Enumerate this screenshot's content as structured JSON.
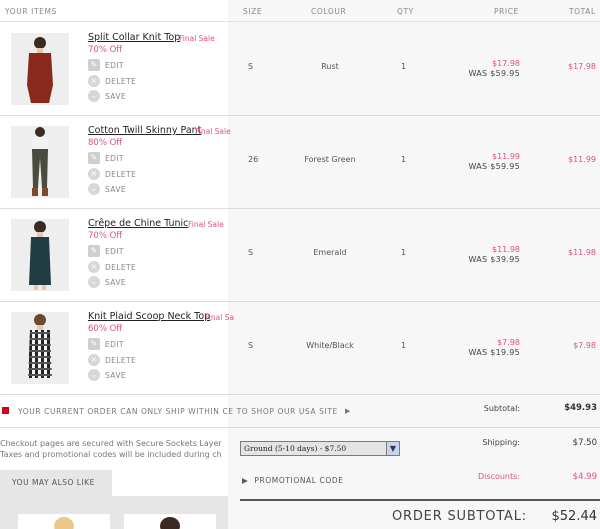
{
  "header": {
    "items": "YOUR ITEMS",
    "size": "SIZE",
    "colour": "COLOUR",
    "qty": "QTY",
    "price": "PRICE",
    "total": "TOTAL"
  },
  "actions": {
    "edit": "EDIT",
    "delete": "DELETE",
    "save": "SAVE"
  },
  "items": [
    {
      "name": "Split Collar Knit Top",
      "final": "Final Sale",
      "off": "70% Off",
      "size": "S",
      "colour": "Rust",
      "qty": "1",
      "price": "$17.98",
      "was": "WAS $59.95",
      "total": "$17.98",
      "image_color": "#8a2a1e"
    },
    {
      "name": "Cotton Twill Skinny Pant",
      "final": "Final Sale",
      "off": "80% Off",
      "size": "26",
      "colour": "Forest Green",
      "qty": "1",
      "price": "$11.99",
      "was": "WAS $59.95",
      "total": "$11.99",
      "image_color": "#4a4d3e"
    },
    {
      "name": "Crêpe de Chine Tunic",
      "final": "Final Sale",
      "off": "70% Off",
      "size": "S",
      "colour": "Emerald",
      "qty": "1",
      "price": "$11.98",
      "was": "WAS $39.95",
      "total": "$11.98",
      "image_color": "#1f3d42"
    },
    {
      "name": "Knit Plaid Scoop Neck Top",
      "final": "Final Sa",
      "off": "60% Off",
      "size": "S",
      "colour": "White/Black",
      "qty": "1",
      "price": "$7.98",
      "was": "WAS $19.95",
      "total": "$7.98",
      "image_color": "#2a2a2a"
    }
  ],
  "ship_note": "YOUR CURRENT ORDER CAN ONLY SHIP WITHIN CE TO SHOP OUR USA SITE",
  "summary": {
    "subtotal_label": "Subtotal:",
    "subtotal": "$49.93",
    "shipping_label": "Shipping:",
    "shipping": "$7.50",
    "discounts_label": "Discounts:",
    "discounts": "$4.99",
    "order_subtotal_label": "ORDER SUBTOTAL:",
    "order_subtotal": "$52.44"
  },
  "shipping_select": "Ground (5-10 days) - $7.50",
  "promo": "PROMOTIONAL CODE",
  "secure_line1": "Checkout pages are secured with Secure Sockets Layer",
  "secure_line2": "Taxes and promotional codes will be included during ch",
  "you_may_also_like": "YOU MAY ALSO LIKE",
  "colors": {
    "accent": "#e0527a",
    "panel": "#f7f7f7"
  }
}
